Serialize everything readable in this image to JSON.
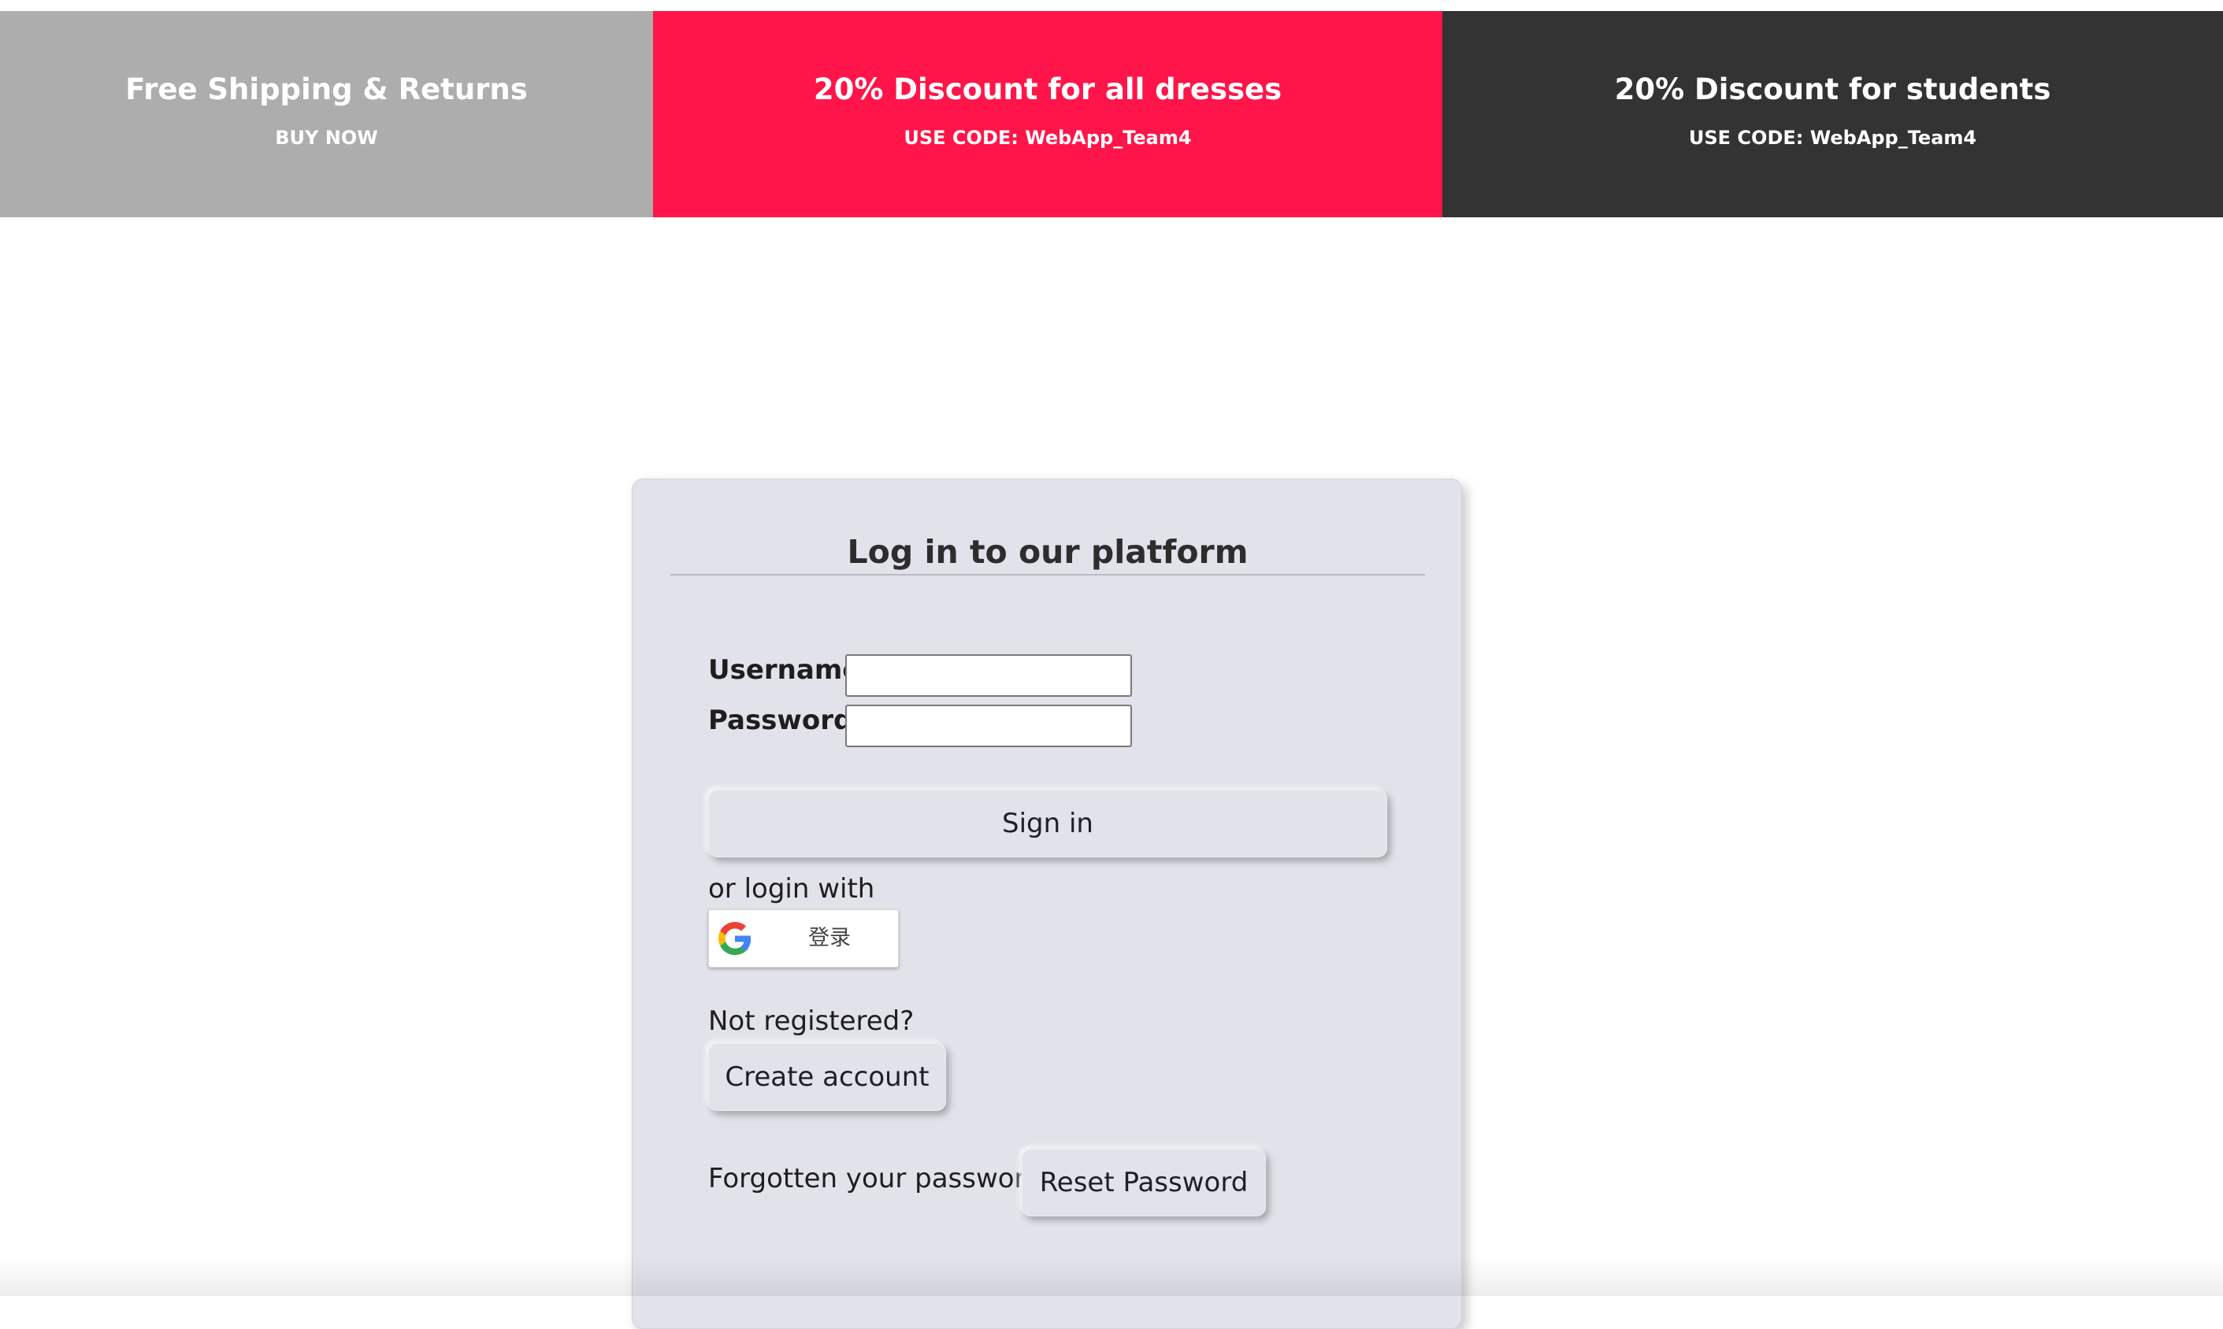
{
  "promos": [
    {
      "title": "Free Shipping & Returns",
      "subtitle": "BUY NOW",
      "color": "#adadad"
    },
    {
      "title": "20% Discount for all dresses",
      "subtitle": "USE CODE: WebApp_Team4",
      "color": "#ff1549"
    },
    {
      "title": "20% Discount for students",
      "subtitle": "USE CODE: WebApp_Team4",
      "color": "#333333"
    }
  ],
  "login": {
    "title": "Log in to our platform",
    "username_label": "Username:",
    "username_value": "",
    "password_label": "Password:",
    "password_value": "",
    "signin_label": "Sign in",
    "or_login_text": "or login with",
    "google_label": "登录",
    "google_icon": "google-g-icon",
    "not_registered_text": "Not registered?",
    "create_account_label": "Create account",
    "forgot_text": "Forgotten your password?",
    "reset_label": "Reset Password",
    "card_color": "#e1e2ea"
  }
}
